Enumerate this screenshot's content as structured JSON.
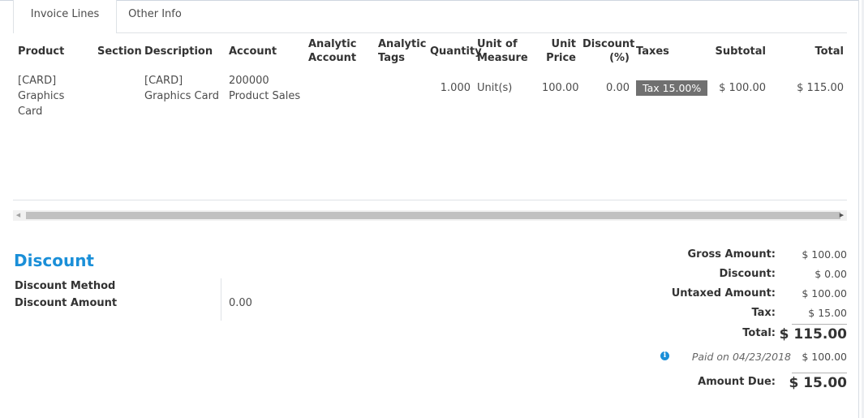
{
  "tabs": [
    {
      "label": "Invoice Lines",
      "active": true
    },
    {
      "label": "Other Info",
      "active": false
    }
  ],
  "table": {
    "headers": {
      "product": "Product",
      "section": "Section",
      "description": "Description",
      "account": "Account",
      "analytic_account": "Analytic Account",
      "analytic_tags": "Analytic Tags",
      "quantity": "Quantity",
      "uom": "Unit of Measure",
      "unit_price": "Unit Price",
      "discount": "Discount (%)",
      "taxes": "Taxes",
      "subtotal": "Subtotal",
      "total": "Total"
    },
    "rows": [
      {
        "product": "[CARD] Graphics Card",
        "section": "",
        "description": "[CARD] Graphics Card",
        "account": "200000 Product Sales",
        "analytic_account": "",
        "analytic_tags": "",
        "quantity": "1.000",
        "uom": "Unit(s)",
        "unit_price": "100.00",
        "discount": "0.00",
        "tax": "Tax 15.00%",
        "subtotal": "$ 100.00",
        "total": "$ 115.00"
      }
    ]
  },
  "discount": {
    "title": "Discount",
    "method_label": "Discount Method",
    "amount_label": "Discount Amount",
    "amount_value": "0.00"
  },
  "totals": {
    "gross_label": "Gross Amount:",
    "gross_value": "$ 100.00",
    "discount_label": "Discount:",
    "discount_value": "$ 0.00",
    "untaxed_label": "Untaxed Amount:",
    "untaxed_value": "$ 100.00",
    "tax_label": "Tax:",
    "tax_value": "$ 15.00",
    "total_label": "Total:",
    "total_value": "$ 115.00",
    "paid_on_text": "Paid on 04/23/2018",
    "paid_amount": "$ 100.00",
    "amount_due_label": "Amount Due:",
    "amount_due_value": "$ 15.00"
  },
  "colors": {
    "accent": "#1a8fd8",
    "tax_tag_bg": "#707070"
  },
  "icons": {
    "info": "info-circle-icon",
    "scroll_left": "caret-left-icon",
    "scroll_right": "caret-right-icon"
  }
}
